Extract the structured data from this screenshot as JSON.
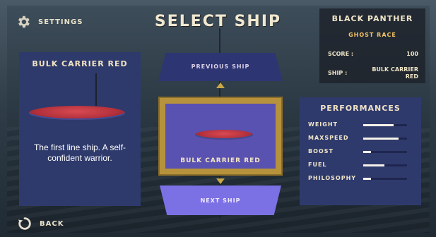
{
  "header": {
    "title": "SELECT SHIP",
    "settings_label": "SETTINGS"
  },
  "profile": {
    "name": "BLACK PANTHER",
    "subtitle": "GHOST RACE",
    "score_label": "SCORE :",
    "score_value": "100",
    "ship_label": "SHIP :",
    "ship_value": "BULK CARRIER RED"
  },
  "ship_info": {
    "name": "BULK CARRIER RED",
    "description": "The first line ship. A self-confident warrior."
  },
  "carousel": {
    "previous_label": "PREVIOUS SHIP",
    "selected_label": "BULK CARRIER RED",
    "next_label": "NEXT SHIP"
  },
  "performances": {
    "title": "PERFORMANCES",
    "stats": [
      {
        "label": "WEIGHT",
        "value": 0.7
      },
      {
        "label": "MAXSPEED",
        "value": 0.8
      },
      {
        "label": "BOOST",
        "value": 0.18
      },
      {
        "label": "FUEL",
        "value": 0.48
      },
      {
        "label": "PHILOSOPHY",
        "value": 0.18
      }
    ]
  },
  "footer": {
    "back_label": "BACK"
  },
  "colors": {
    "accent_gold": "#b7923c",
    "panel_blue": "#2e3a6b",
    "highlight_yellow": "#f2c463"
  }
}
